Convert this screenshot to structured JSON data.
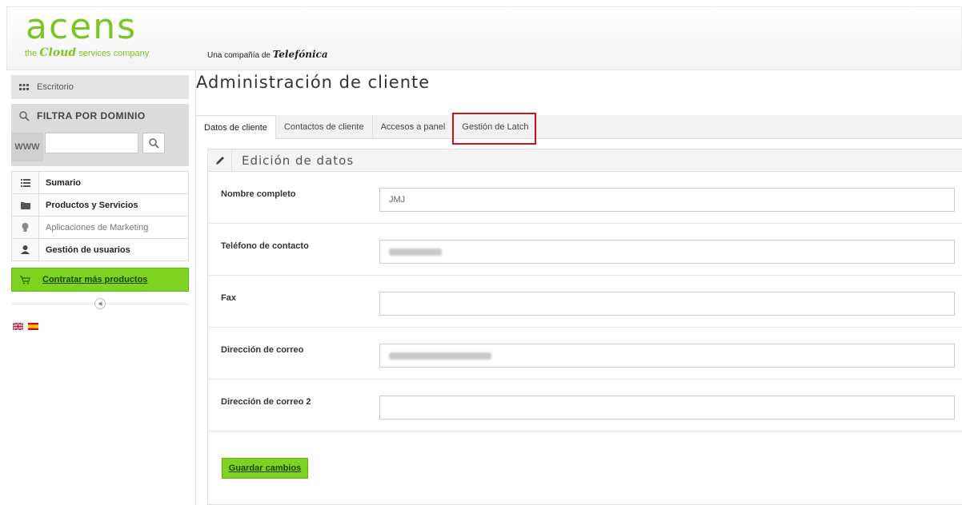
{
  "header": {
    "logo": "acens",
    "tagline_prefix": "the ",
    "tagline_cloud": "Cloud",
    "tagline_suffix": " services company",
    "partner_prefix": "Una compañía de ",
    "partner_name": "Telefónica"
  },
  "sidebar": {
    "escritorio": "Escritorio",
    "filter_title": "FILTRA POR DOMINIO",
    "www_label": "WWW",
    "domain_value": "",
    "items": [
      {
        "label": "Sumario",
        "icon": "list-icon"
      },
      {
        "label": "Productos y Servicios",
        "icon": "folder-icon"
      },
      {
        "label": "Aplicaciones de Marketing",
        "icon": "lightbulb-icon"
      },
      {
        "label": "Gestión de usuarios",
        "icon": "user-icon"
      }
    ],
    "buy_label": "Contratar más productos",
    "languages": [
      "English",
      "Español"
    ]
  },
  "page": {
    "title": "Administración de cliente",
    "tabs": [
      "Datos de cliente",
      "Contactos de cliente",
      "Accesos a panel",
      "Gestión de Latch"
    ],
    "active_tab": "Datos de cliente",
    "highlighted_tab": "Gestión de Latch",
    "panel_title": "Edición de datos",
    "fields": [
      {
        "label": "Nombre completo",
        "value": "JMJ"
      },
      {
        "label": "Teléfono de contacto",
        "value": ""
      },
      {
        "label": "Fax",
        "value": ""
      },
      {
        "label": "Dirección de correo",
        "value": ""
      },
      {
        "label": "Dirección de correo 2",
        "value": ""
      }
    ],
    "save_label": "Guardar cambios"
  },
  "colors": {
    "brand_green": "#7cc624",
    "button_green": "#7ed321",
    "highlight_red": "#d0101b"
  }
}
